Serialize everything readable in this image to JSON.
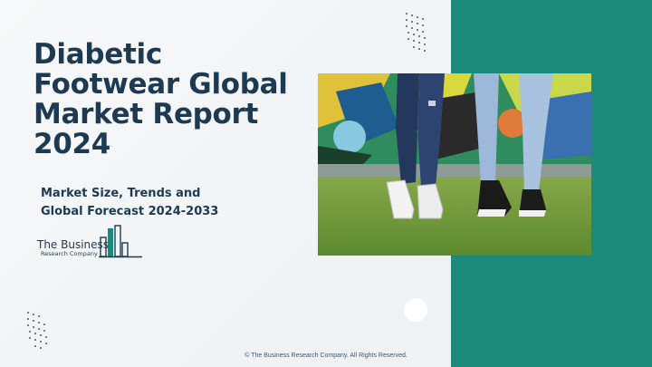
{
  "slide": {
    "title": "Diabetic\nFootwear Global\nMarket Report\n2024",
    "subtitle": "Market Size, Trends and\nGlobal Forecast 2024-2033",
    "logo": {
      "line1": "The Business",
      "line2": "Research Company"
    },
    "copyright": "© The Business Research Company. All Rights Reserved.",
    "colors": {
      "accent": "#1a8a7d",
      "title": "#1d3a52"
    }
  }
}
